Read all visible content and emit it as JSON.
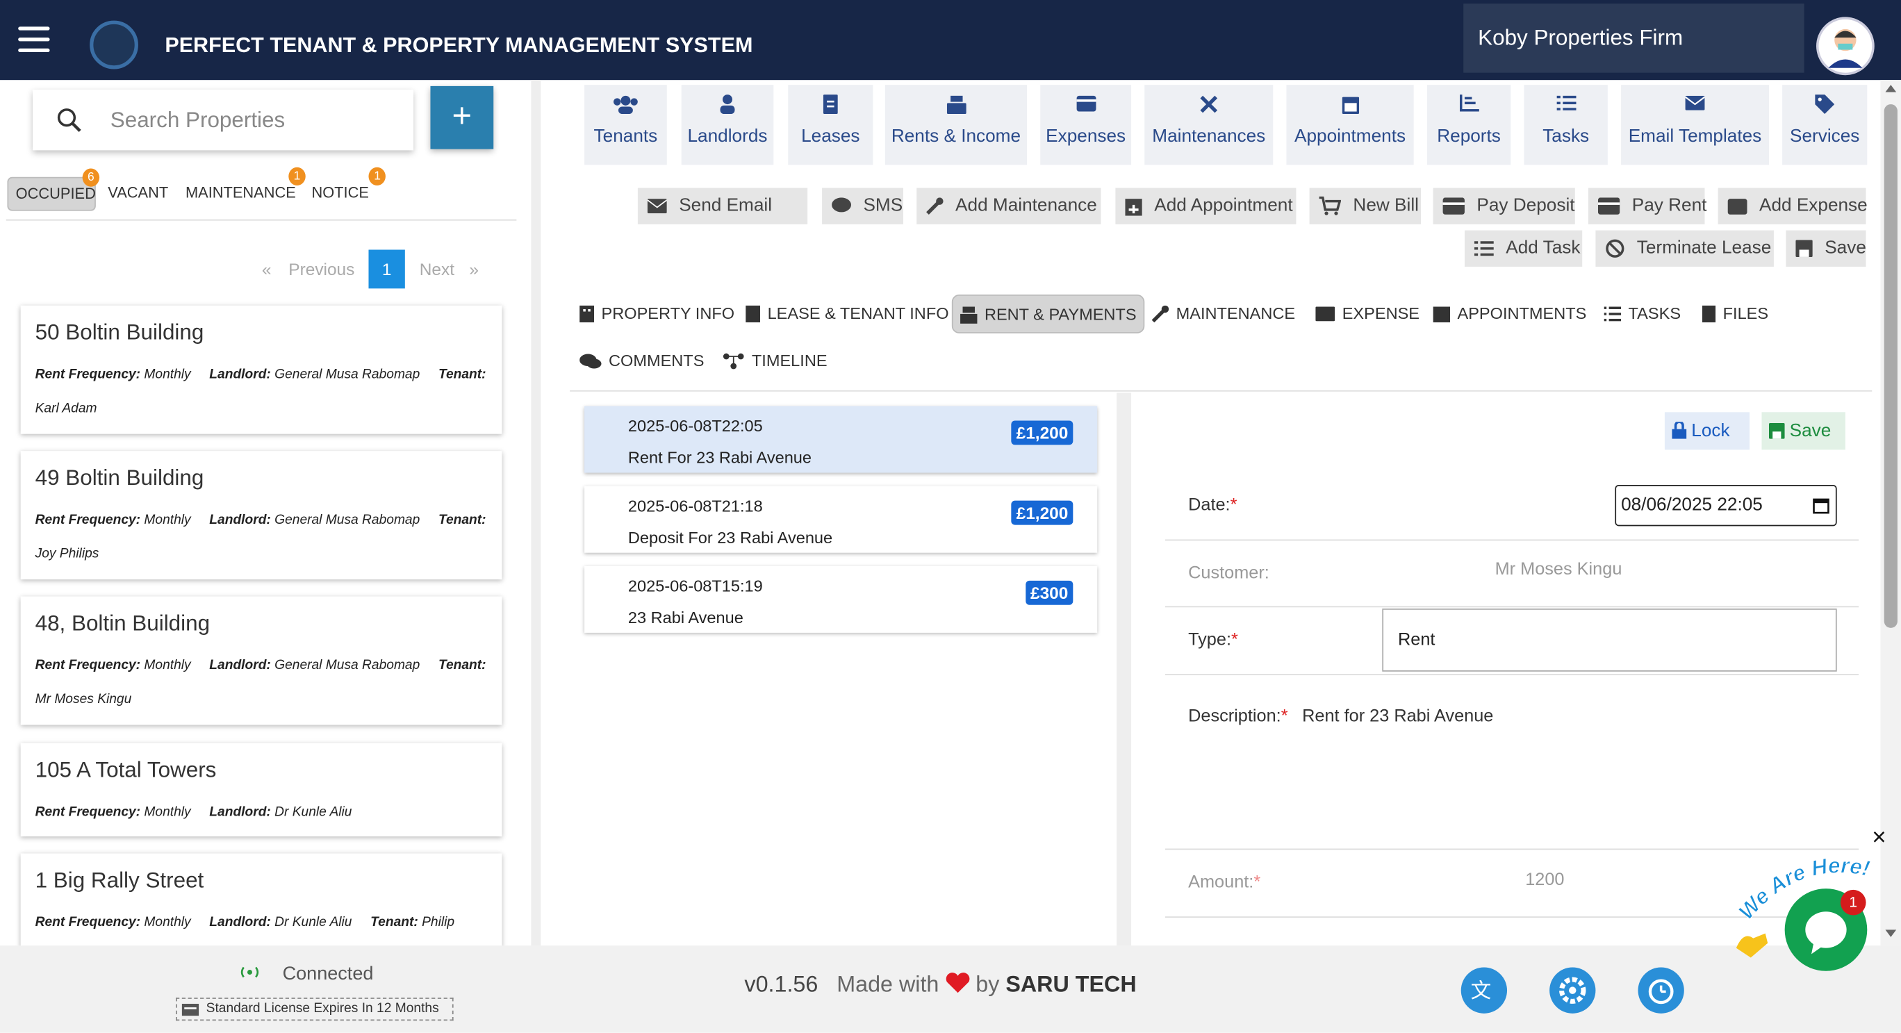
{
  "header": {
    "title": "PERFECT TENANT & PROPERTY MANAGEMENT SYSTEM",
    "firm": "Koby Properties Firm"
  },
  "sidebar": {
    "search_placeholder": "Search Properties",
    "add_label": "+",
    "filters": [
      {
        "label": "OCCUPIED",
        "badge": "6"
      },
      {
        "label": "VACANT",
        "badge": ""
      },
      {
        "label": "MAINTENANCE",
        "badge": "1"
      },
      {
        "label": "NOTICE",
        "badge": "1"
      }
    ],
    "pagination": {
      "prev": "Previous",
      "page": "1",
      "next": "Next",
      "prev_chevron": "«",
      "next_chevron": "»"
    },
    "properties": [
      {
        "name": "50 Boltin Building",
        "frequency_label": "Rent Frequency:",
        "frequency": "Monthly",
        "landlord_label": "Landlord:",
        "landlord": "General Musa Rabomap",
        "tenant_label": "Tenant:",
        "tenant": "Karl Adam"
      },
      {
        "name": "49 Boltin Building",
        "frequency_label": "Rent Frequency:",
        "frequency": "Monthly",
        "landlord_label": "Landlord:",
        "landlord": "General Musa Rabomap",
        "tenant_label": "Tenant:",
        "tenant": "Joy Philips"
      },
      {
        "name": "48, Boltin Building",
        "frequency_label": "Rent Frequency:",
        "frequency": "Monthly",
        "landlord_label": "Landlord:",
        "landlord": "General Musa Rabomap",
        "tenant_label": "Tenant:",
        "tenant": "Mr Moses Kingu"
      },
      {
        "name": "105 A Total Towers",
        "frequency_label": "Rent Frequency:",
        "frequency": "Monthly",
        "landlord_label": "Landlord:",
        "landlord": "Dr Kunle Aliu",
        "tenant_label": "",
        "tenant": ""
      },
      {
        "name": "1 Big Rally Street",
        "frequency_label": "Rent Frequency:",
        "frequency": "Monthly",
        "landlord_label": "Landlord:",
        "landlord": "Dr Kunle Aliu",
        "tenant_label": "Tenant:",
        "tenant": "Philip"
      }
    ]
  },
  "modules": [
    "Tenants",
    "Landlords",
    "Leases",
    "Rents & Income",
    "Expenses",
    "Maintenances",
    "Appointments",
    "Reports",
    "Tasks",
    "Email Templates",
    "Services"
  ],
  "actions": [
    "Send Email",
    "SMS",
    "Add Maintenance",
    "Add Appointment",
    "New Bill",
    "Pay Deposit",
    "Pay Rent",
    "Add Expense",
    "Add Task",
    "Terminate Lease",
    "Save"
  ],
  "tabs": [
    "PROPERTY INFO",
    "LEASE & TENANT INFO",
    "RENT & PAYMENTS",
    "MAINTENANCE",
    "EXPENSE",
    "APPOINTMENTS",
    "TASKS",
    "FILES",
    "COMMENTS",
    "TIMELINE"
  ],
  "transactions": [
    {
      "date": "2025-06-08T22:05",
      "title": "Rent For 23 Rabi Avenue",
      "amount": "£1,200"
    },
    {
      "date": "2025-06-08T21:18",
      "title": "Deposit For 23 Rabi Avenue",
      "amount": "£1,200"
    },
    {
      "date": "2025-06-08T15:19",
      "title": "23 Rabi Avenue",
      "amount": "£300"
    }
  ],
  "form": {
    "lock": "Lock",
    "save": "Save",
    "date_label": "Date:",
    "date_value": "08/06/2025 22:05",
    "customer_label": "Customer:",
    "customer_value": "Mr Moses Kingu",
    "type_label": "Type:",
    "type_value": "Rent",
    "description_label": "Description:",
    "description_value": "Rent for 23 Rabi Avenue",
    "amount_label": "Amount:",
    "amount_value": "1200",
    "required_mark": "*"
  },
  "footer": {
    "status": "Connected",
    "license": "Standard License Expires In 12 Months",
    "version": "v0.1.56",
    "made_with": "Made with",
    "by": "by",
    "company": "SARU TECH"
  },
  "chat": {
    "banner": "We Are Here!",
    "badge": "1",
    "close": "×"
  },
  "colors": {
    "header": "#172647",
    "accent": "#2a7fae",
    "badge": "#f0901f",
    "amount": "#1768d5"
  }
}
